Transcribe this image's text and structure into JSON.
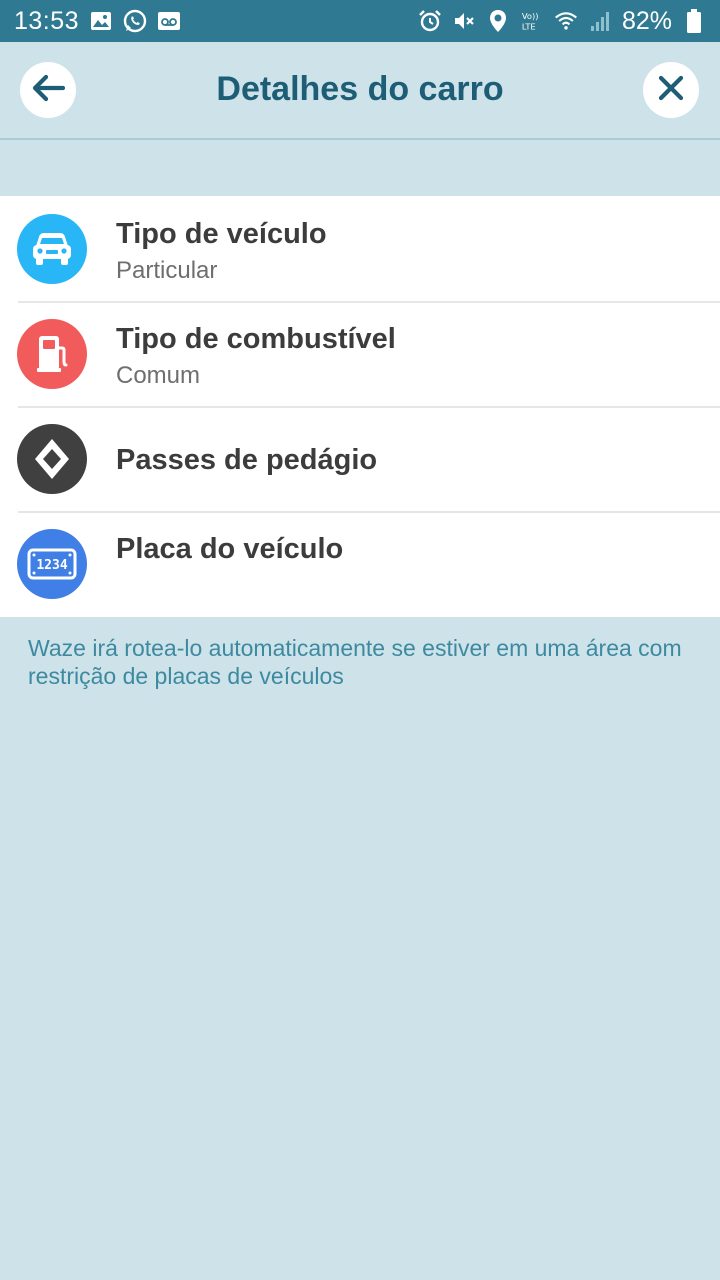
{
  "status_bar": {
    "time": "13:53",
    "battery": "82%"
  },
  "header": {
    "title": "Detalhes do carro"
  },
  "items": [
    {
      "title": "Tipo de veículo",
      "subtitle": "Particular",
      "icon": "car-icon",
      "color": "#29b6f6"
    },
    {
      "title": "Tipo de combustível",
      "subtitle": "Comum",
      "icon": "fuel-pump-icon",
      "color": "#f15b5b"
    },
    {
      "title": "Passes de pedágio",
      "subtitle": "",
      "icon": "toll-diamond-icon",
      "color": "#404040"
    },
    {
      "title": "Placa do veículo",
      "subtitle": "",
      "icon": "license-plate-icon",
      "color": "#3f7fe6",
      "plate_text": "1234"
    }
  ],
  "note": "Waze irá rotea-lo automaticamente se estiver em uma área com restrição de placas de veículos",
  "colors": {
    "status_bar": "#2f7a92",
    "background": "#cde2e9",
    "title": "#1d5d76",
    "note": "#3d8aa0"
  }
}
